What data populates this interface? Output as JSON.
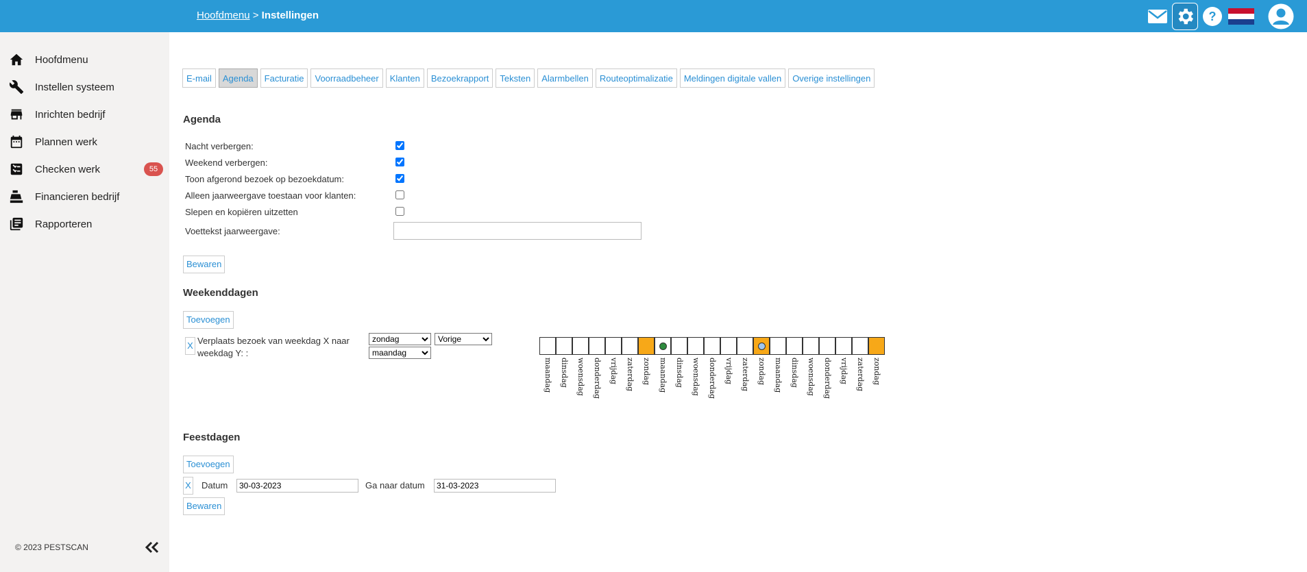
{
  "breadcrumb": {
    "home": "Hoofdmenu",
    "separator": ">",
    "current": "Instellingen"
  },
  "topbar": {
    "icons": [
      "mail-icon",
      "gear-icon",
      "help-icon",
      "dutch-flag-icon",
      "user-avatar-icon"
    ],
    "accent": "#2a9ad6"
  },
  "sidebar": {
    "items": [
      {
        "label": "Hoofdmenu",
        "icon": "home-icon"
      },
      {
        "label": "Instellen systeem",
        "icon": "wrench-icon"
      },
      {
        "label": "Inrichten bedrijf",
        "icon": "store-icon"
      },
      {
        "label": "Plannen werk",
        "icon": "calendar-icon"
      },
      {
        "label": "Checken werk",
        "icon": "checklist-icon",
        "badge": "55"
      },
      {
        "label": "Financieren bedrijf",
        "icon": "cash-register-icon"
      },
      {
        "label": "Rapporteren",
        "icon": "report-icon"
      }
    ],
    "copyright": "© 2023 PESTSCAN"
  },
  "tabs": [
    "E-mail",
    "Agenda",
    "Facturatie",
    "Voorraadbeheer",
    "Klanten",
    "Bezoekrapport",
    "Teksten",
    "Alarmbellen",
    "Routeoptimalizatie",
    "Meldingen digitale vallen",
    "Overige instellingen"
  ],
  "active_tab": "Agenda",
  "agenda": {
    "title": "Agenda",
    "options": [
      {
        "label": "Nacht verbergen:",
        "checked": true
      },
      {
        "label": "Weekend verbergen:",
        "checked": true
      },
      {
        "label": "Toon afgerond bezoek op bezoekdatum:",
        "checked": true
      },
      {
        "label": "Alleen jaarweergave toestaan voor klanten:",
        "checked": false
      },
      {
        "label": "Slepen en kopiëren uitzetten",
        "checked": false
      }
    ],
    "footer_label": "Voettekst jaarweergave:",
    "footer_value": "",
    "save": "Bewaren"
  },
  "weekend": {
    "title": "Weekenddagen",
    "add": "Toevoegen",
    "remove": "X",
    "rule_label": "Verplaats bezoek van weekdag X naar weekdag Y: :",
    "from_day": "zondag",
    "direction": "Vorige",
    "to_day": "maandag",
    "days": [
      "maandag",
      "dinsdag",
      "woensdag",
      "donderdag",
      "vrijdag",
      "zaterdag",
      "zondag",
      "maandag",
      "dinsdag",
      "woensdag",
      "donderdag",
      "vrijdag",
      "zaterdag",
      "zondag",
      "maandag",
      "dinsdag",
      "woensdag",
      "donderdag",
      "vrijdag",
      "zaterdag",
      "zondag"
    ],
    "weekend_color": "#f7a818",
    "target_dot_color": "#2e8b3e",
    "source_dot_color": "#9ec6f0"
  },
  "holidays": {
    "title": "Feestdagen",
    "add": "Toevoegen",
    "remove": "X",
    "date_label": "Datum",
    "date_value": "30-03-2023",
    "goto_label": "Ga naar datum",
    "goto_value": "31-03-2023",
    "save": "Bewaren"
  }
}
